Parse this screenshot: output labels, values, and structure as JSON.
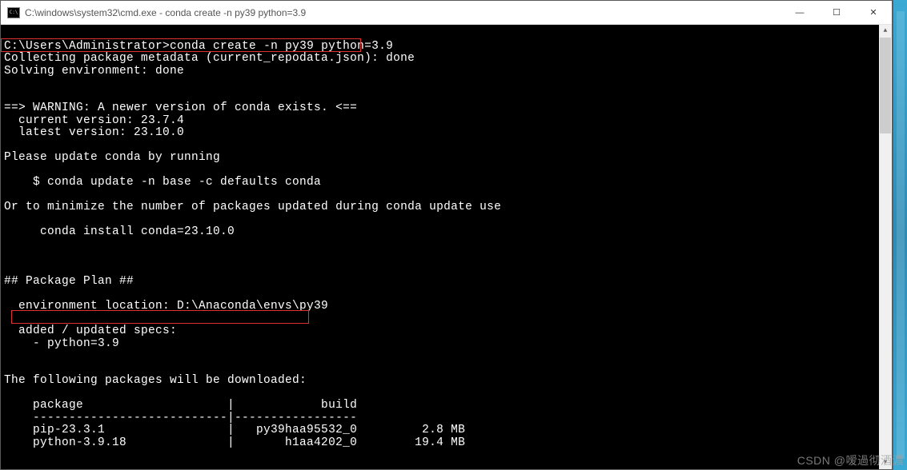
{
  "titlebar": {
    "title": "C:\\windows\\system32\\cmd.exe - conda  create -n py39 python=3.9"
  },
  "buttons": {
    "minimize": "—",
    "maximize": "☐",
    "close": "✕"
  },
  "lines": {
    "blank": "",
    "prompt_prefix": "C:\\Users\\Administrator>",
    "cmd": "conda create -n py39 python=3.9",
    "l1": "Collecting package metadata (current_repodata.json): done",
    "l2": "Solving environment: done",
    "l3": "==> WARNING: A newer version of conda exists. <==",
    "l4": "  current version: 23.7.4",
    "l5": "  latest version: 23.10.0",
    "l6": "Please update conda by running",
    "l7": "    $ conda update -n base -c defaults conda",
    "l8": "Or to minimize the number of packages updated during conda update use",
    "l9": "     conda install conda=23.10.0",
    "l10": "## Package Plan ##",
    "l11": "  environment location: D:\\Anaconda\\envs\\py39",
    "l12": "  added / updated specs:",
    "l13": "    - python=3.9",
    "l14": "The following packages will be downloaded:",
    "l15": "    package                    |            build",
    "l16": "    ---------------------------|-----------------",
    "l17": "    pip-23.3.1                 |   py39haa95532_0         2.8 MB",
    "l18": "    python-3.9.18              |       h1aa4202_0        19.4 MB"
  },
  "watermark": "CSDN @嗳過彻酒濃"
}
